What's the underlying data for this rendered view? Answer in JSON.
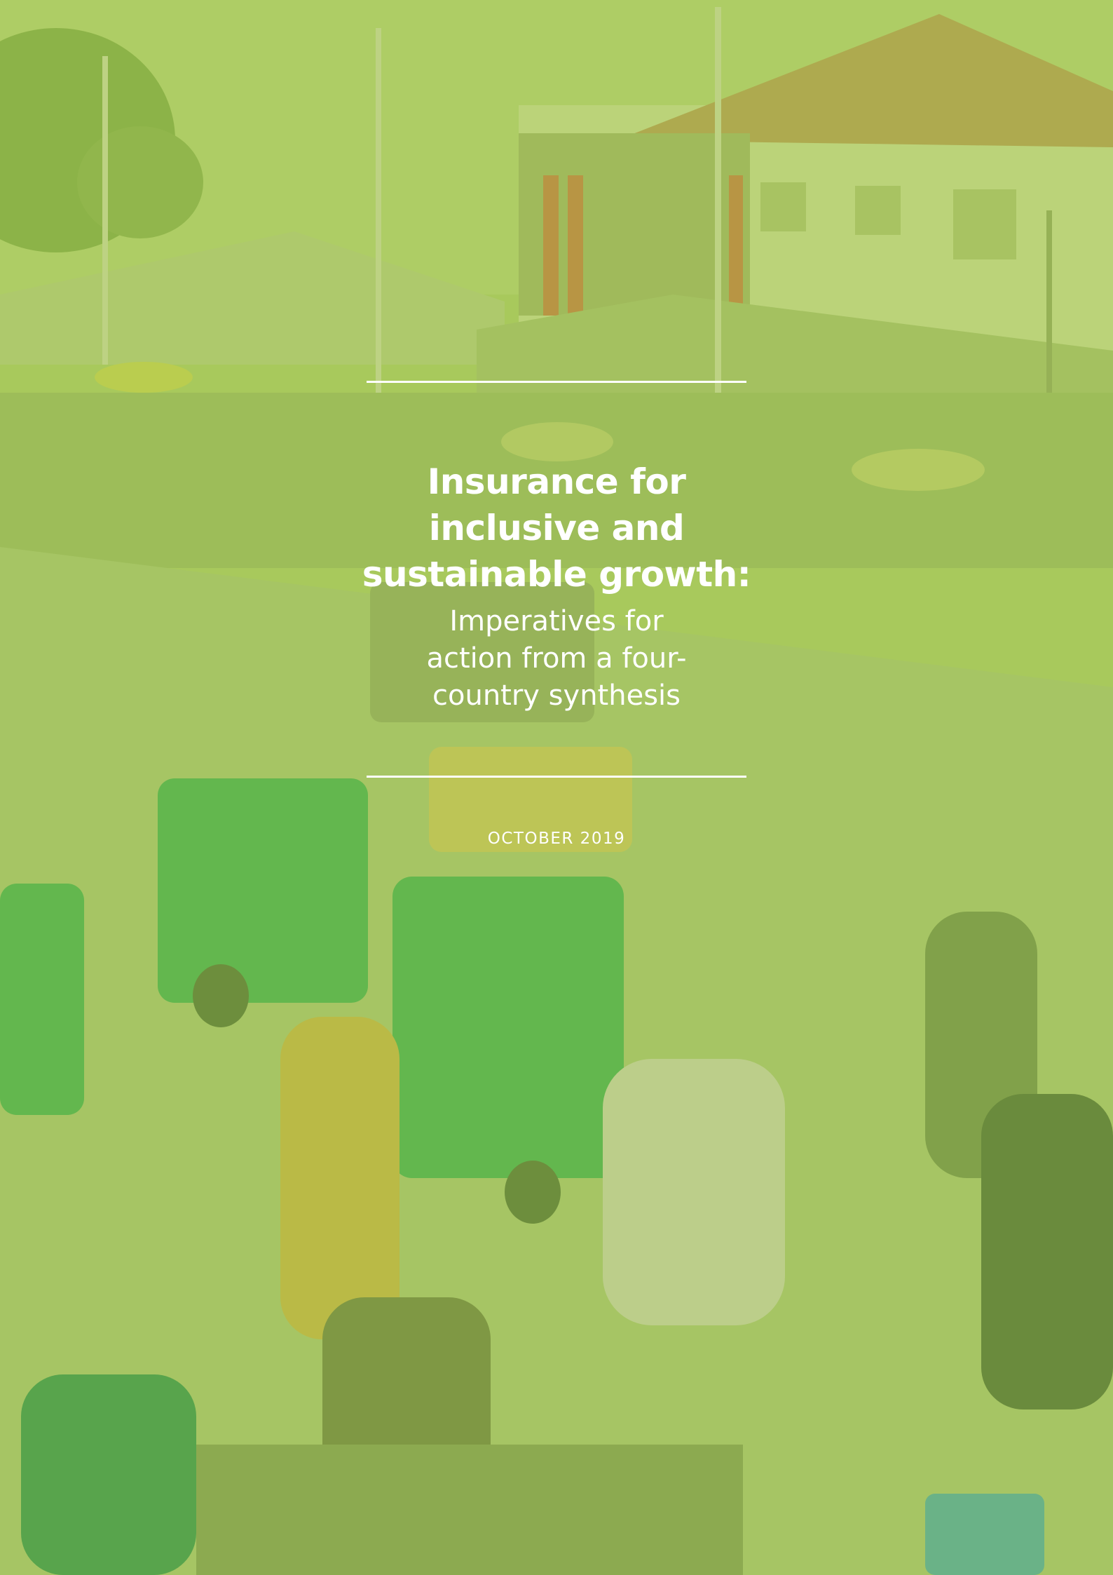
{
  "cover": {
    "title_lines": [
      "Insurance for",
      "inclusive and",
      "sustainable growth:"
    ],
    "subtitle_lines": [
      "Imperatives for",
      "action from a four-",
      "country synthesis"
    ],
    "date": "OCTOBER 2019",
    "colors": {
      "overlay_green": "#a9c95f",
      "text": "#ffffff",
      "tuk_tuk_green": "#3fae49",
      "roof_orange": "#c98a3a"
    }
  }
}
